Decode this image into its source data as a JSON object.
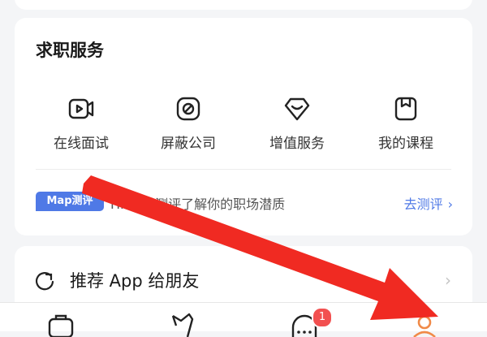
{
  "job_services": {
    "title": "求职服务",
    "items": [
      {
        "label": "在线面试",
        "icon": "video-interview-icon"
      },
      {
        "label": "屏蔽公司",
        "icon": "block-company-icon"
      },
      {
        "label": "增值服务",
        "icon": "value-added-icon"
      },
      {
        "label": "我的课程",
        "icon": "my-courses-icon"
      }
    ]
  },
  "map_eval": {
    "badge": "Map测评",
    "text": "HR通过测评了解你的职场潜质",
    "link": "去测评"
  },
  "recommend": {
    "label": "推荐 App 给朋友",
    "icon": "share-refresh-icon"
  },
  "tabbar": {
    "tabs": [
      {
        "icon": "briefcase-icon"
      },
      {
        "icon": "discover-icon"
      },
      {
        "icon": "message-icon",
        "badge": "1"
      },
      {
        "icon": "profile-icon",
        "active": true
      }
    ]
  },
  "colors": {
    "accent": "#4f79e6",
    "active_tab": "#f08a48",
    "badge": "#f25050",
    "annotation_arrow": "#f02a22"
  }
}
